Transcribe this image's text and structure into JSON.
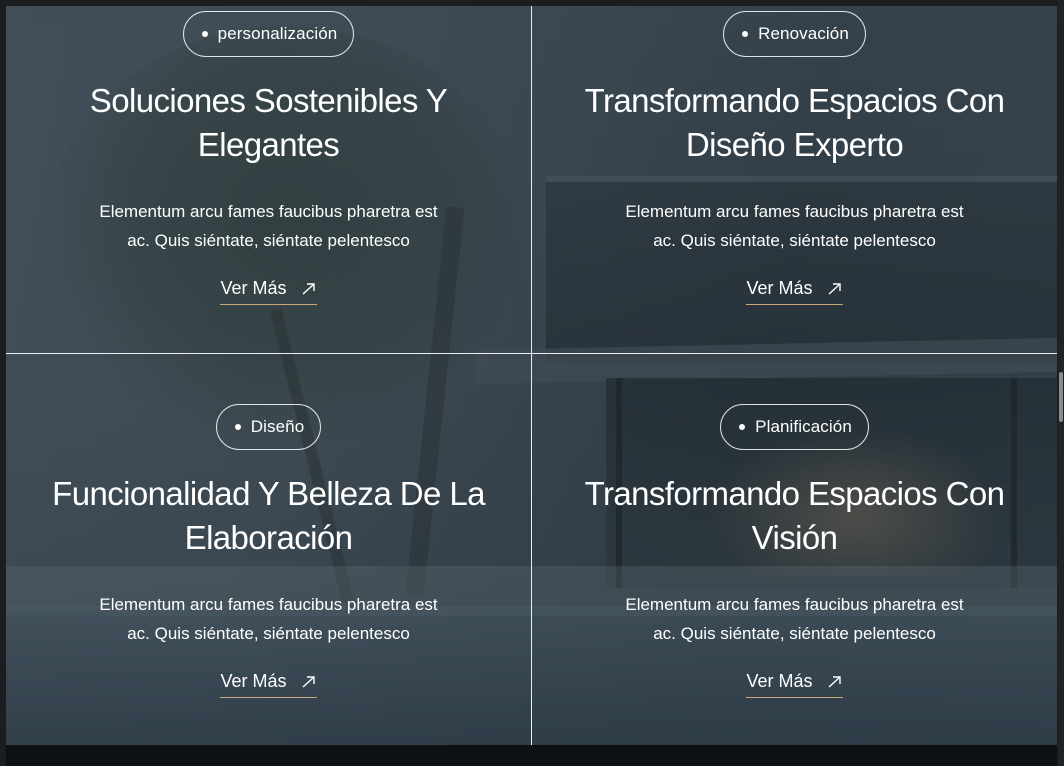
{
  "cards": [
    {
      "tag": "personalización",
      "title": "Soluciones Sostenibles Y Elegantes",
      "description": "Elementum arcu fames faucibus pharetra est ac. Quis siéntate, siéntate pelentesco",
      "link": "Ver Más"
    },
    {
      "tag": "Renovación",
      "title": "Transformando Espacios Con Diseño Experto",
      "description": "Elementum arcu fames faucibus pharetra est ac. Quis siéntate, siéntate pelentesco",
      "link": "Ver Más"
    },
    {
      "tag": "Diseño",
      "title": "Funcionalidad Y Belleza De La Elaboración",
      "description": "Elementum arcu fames faucibus pharetra est ac. Quis siéntate, siéntate pelentesco",
      "link": "Ver Más"
    },
    {
      "tag": "Planificación",
      "title": "Transformando Espacios Con Visión",
      "description": "Elementum arcu fames faucibus pharetra est ac. Quis siéntate, siéntate pelentesco",
      "link": "Ver Más"
    }
  ],
  "icons": {
    "tag_bullet": "dot-icon",
    "link_arrow": "arrow-up-right-icon"
  },
  "colors": {
    "link_underline": "#c9a77c",
    "text": "#ffffff",
    "footer": "#0e1114"
  }
}
